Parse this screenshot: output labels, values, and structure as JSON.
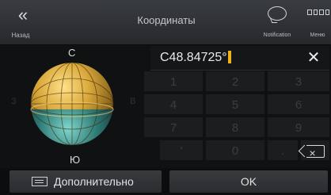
{
  "header": {
    "back_label": "Назад",
    "title": "Координаты",
    "notification_label": "Notification",
    "menu_label": "Меню"
  },
  "globe": {
    "north": "С",
    "south": "Ю",
    "west": "З",
    "east": "В"
  },
  "coordinate": {
    "value": "С48.84725°",
    "clear_glyph": "✕"
  },
  "keypad": {
    "keys": [
      "1",
      "2",
      "3",
      "4",
      "5",
      "6",
      "7",
      "8",
      "9",
      "'",
      "0",
      "."
    ]
  },
  "footer": {
    "more_label": "Дополнительно",
    "ok_label": "OK"
  },
  "colors": {
    "accent": "#f3b41b",
    "globe_top": "#d9a83a",
    "globe_bottom": "#3e8f8a"
  }
}
